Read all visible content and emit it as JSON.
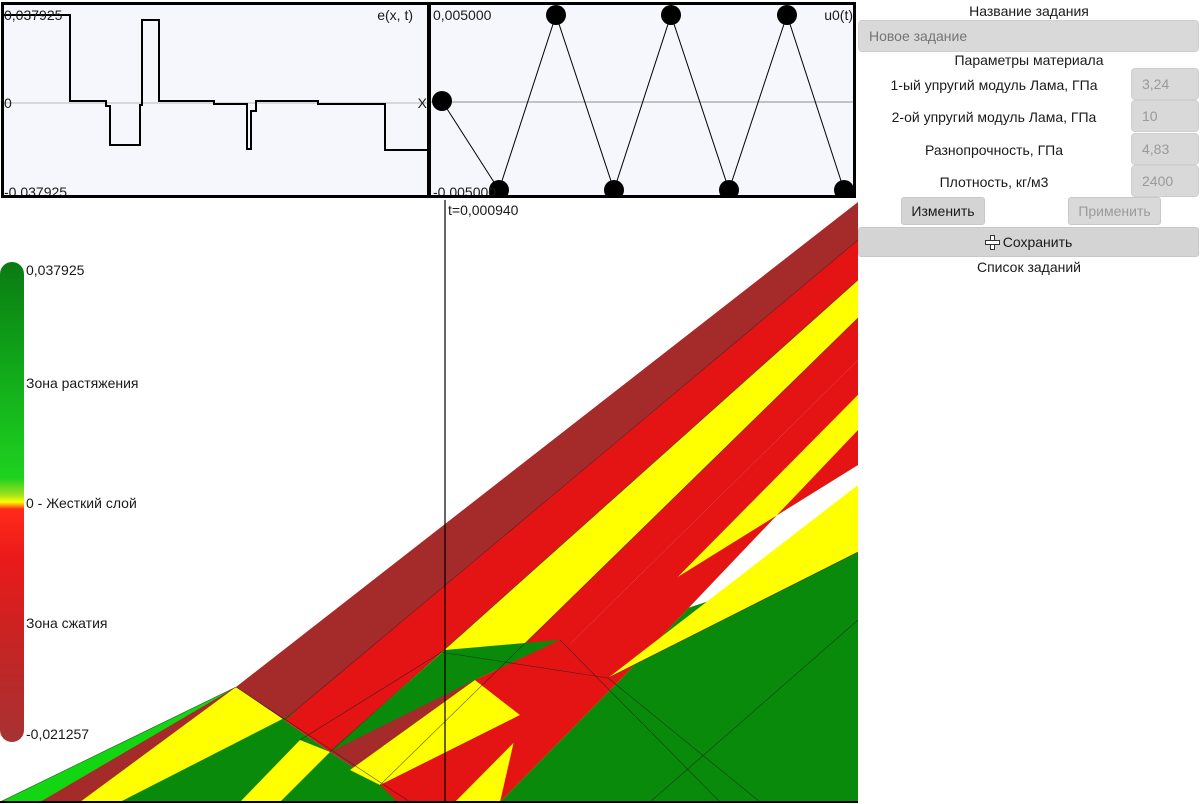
{
  "plot_e": {
    "title": "e(x, t)",
    "y_max_label": "0,037925",
    "y_zero_label": "0",
    "y_min_label": "-0,037925",
    "x_axis_label": "X",
    "line_color": "#000000"
  },
  "plot_u": {
    "title": "u0(t)",
    "y_max_label": "0,005000",
    "y_min_label": "-0,005000",
    "line_color": "#000000"
  },
  "main": {
    "time_label": "t=0,000940",
    "colors": {
      "dark_red": "#a52a2a",
      "red": "#e41414",
      "yellow": "#ffff00",
      "green": "#0a8a0a",
      "light_green": "#11d611",
      "mid_green": "#0e9e10"
    }
  },
  "legend": {
    "max_label": "0,037925",
    "tension_label": "Зона растяжения",
    "zero_label": "0 - Жесткий слой",
    "compression_label": "Зона сжатия",
    "min_label": "-0,021257"
  },
  "panel": {
    "task_name_header": "Название задания",
    "task_name_placeholder": "Новое задание",
    "material_header": "Параметры материала",
    "params": [
      {
        "label": "1-ый упругий модуль Лама, ГПа",
        "value": "3,24"
      },
      {
        "label": "2-ой упругий модуль Лама, ГПа",
        "value": "10"
      },
      {
        "label": "Разнопрочность, ГПа",
        "value": "4,83"
      },
      {
        "label": "Плотность, кг/м3",
        "value": "2400"
      }
    ],
    "edit_button": "Изменить",
    "apply_button": "Применить",
    "save_button": "Сохранить",
    "tasks_list_header": "Список заданий"
  }
}
